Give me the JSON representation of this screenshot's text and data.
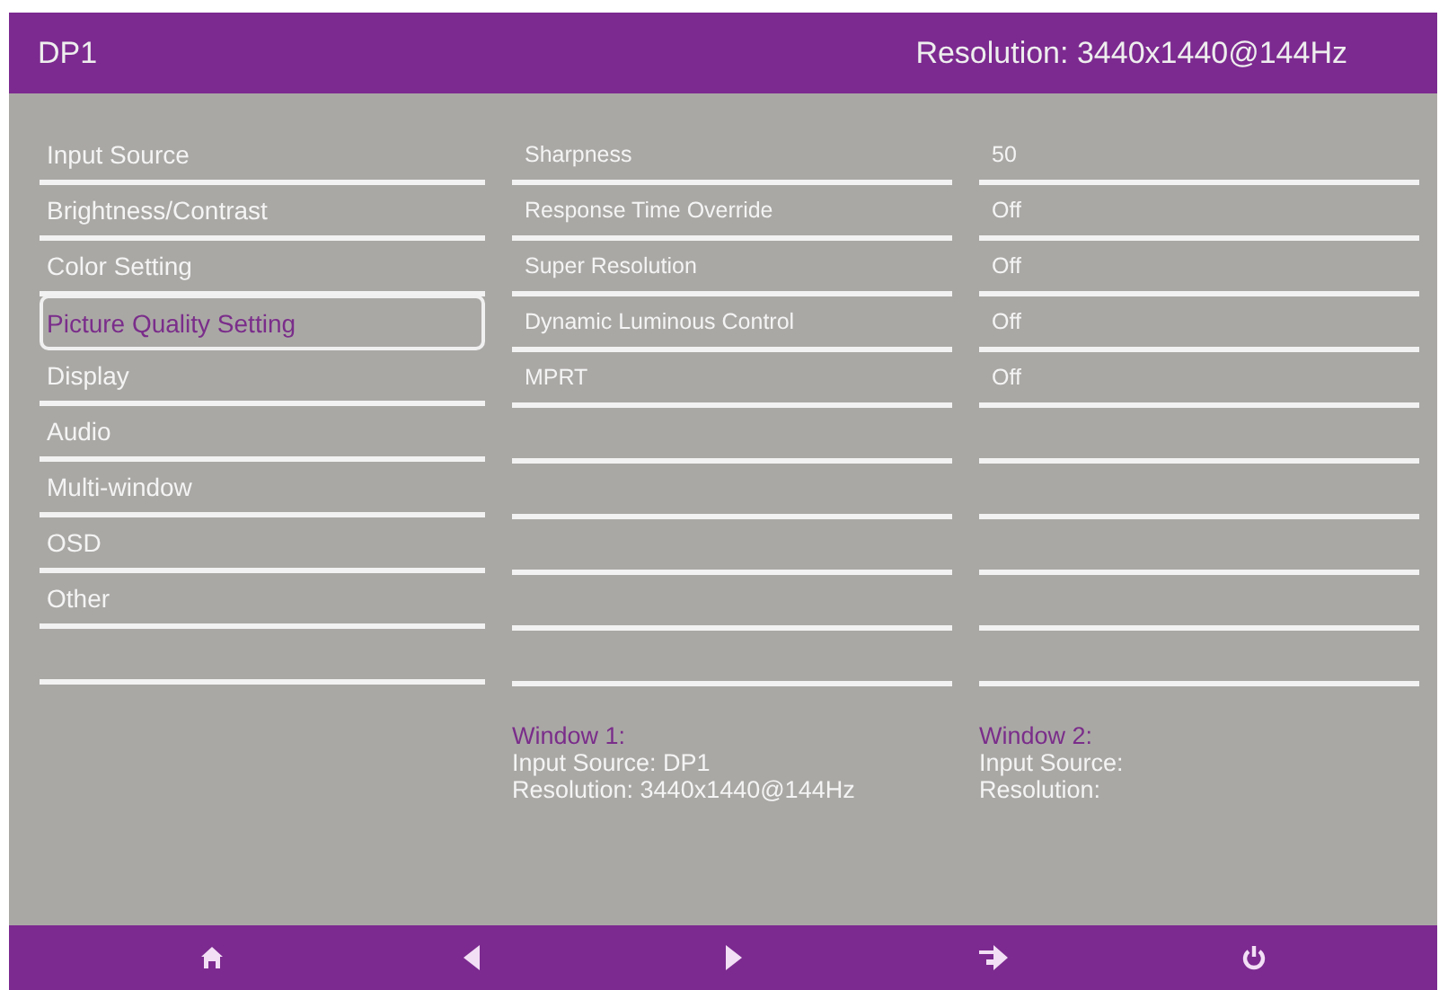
{
  "header": {
    "source": "DP1",
    "resolution": "Resolution: 3440x1440@144Hz"
  },
  "menu": [
    {
      "label": "Input Source",
      "selected": false
    },
    {
      "label": "Brightness/Contrast",
      "selected": false
    },
    {
      "label": "Color Setting",
      "selected": false
    },
    {
      "label": "Picture Quality Setting",
      "selected": true
    },
    {
      "label": "Display",
      "selected": false
    },
    {
      "label": "Audio",
      "selected": false
    },
    {
      "label": "Multi-window",
      "selected": false
    },
    {
      "label": "OSD",
      "selected": false
    },
    {
      "label": "Other",
      "selected": false
    }
  ],
  "settings": [
    {
      "name": "Sharpness",
      "value": "50"
    },
    {
      "name": "Response Time Override",
      "value": "Off"
    },
    {
      "name": "Super Resolution",
      "value": "Off"
    },
    {
      "name": "Dynamic Luminous Control",
      "value": "Off"
    },
    {
      "name": "MPRT",
      "value": "Off"
    }
  ],
  "windows": [
    {
      "title": "Window 1:",
      "lines": [
        "Input Source: DP1",
        "Resolution: 3440x1440@144Hz"
      ]
    },
    {
      "title": "Window 2:",
      "lines": [
        "Input Source:",
        "Resolution:"
      ]
    }
  ],
  "footer": [
    {
      "kind": "home"
    },
    {
      "kind": "left"
    },
    {
      "kind": "right"
    },
    {
      "kind": "enter"
    },
    {
      "kind": "power"
    }
  ]
}
